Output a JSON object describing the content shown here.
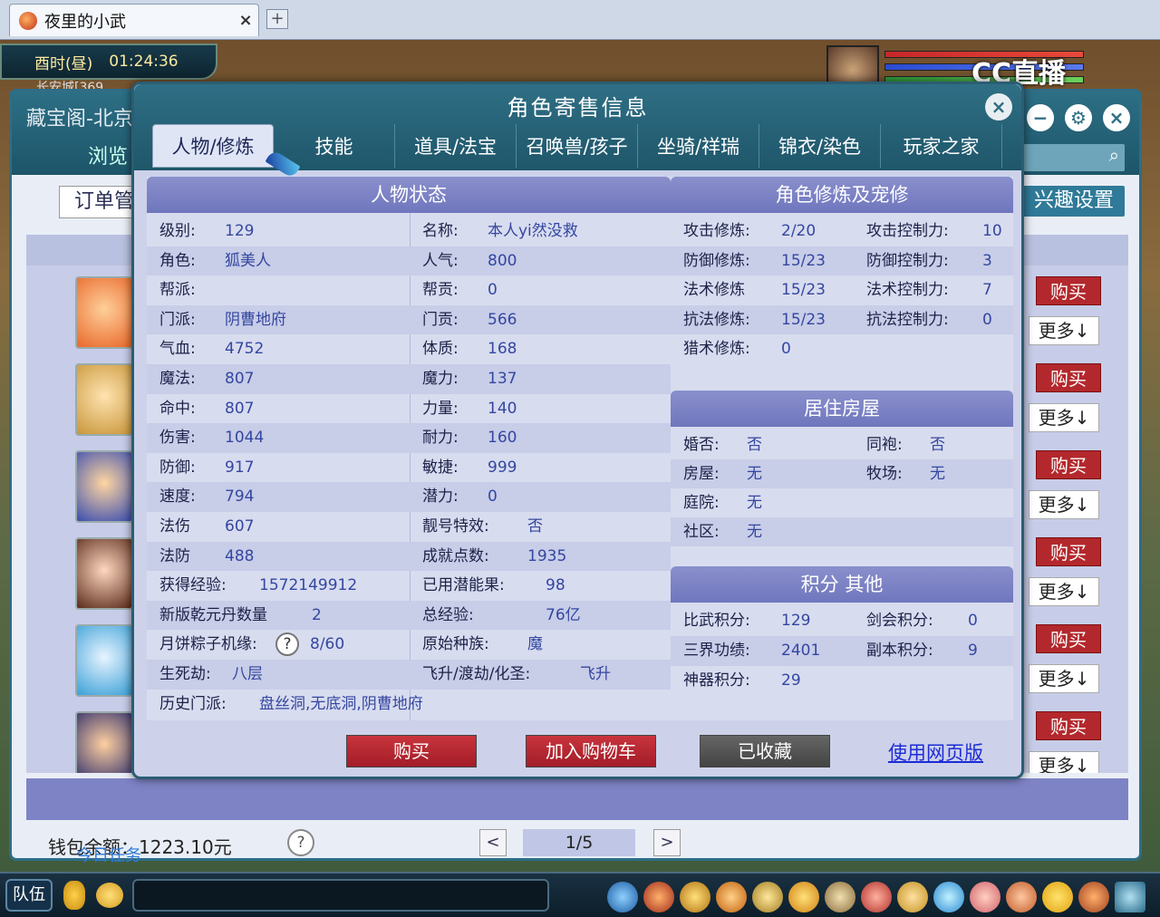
{
  "browser": {
    "tab_title": "夜里的小武",
    "tab_close": "×",
    "new_tab": "+"
  },
  "hud": {
    "time_period": "酉时(昼)",
    "clock": "01:24:36",
    "location": "长安城[369",
    "stream_logo": "CC直播",
    "team_button": "队伍",
    "daily_task": "今日任务"
  },
  "cbg": {
    "title": "藏宝阁-北京",
    "browse_label": "浏览",
    "order_button": "订单管",
    "interest_button": "兴趣设置",
    "side_buy_label": "购买",
    "side_more_label": "更多↓",
    "wallet": "钱包余额：1223.10元",
    "help": "?",
    "pager_prev": "<",
    "pager_next": ">",
    "pager": "1/5"
  },
  "modal": {
    "title": "角色寄售信息",
    "close": "×",
    "tabs": [
      "人物/修炼",
      "技能",
      "道具/法宝",
      "召唤兽/孩子",
      "坐骑/祥瑞",
      "锦衣/染色",
      "玩家之家"
    ],
    "active_tab": 0,
    "status": {
      "heading": "人物状态",
      "rows": [
        {
          "l1": "级别:",
          "v1": "129",
          "l2": "名称:",
          "v2": "本人yi然没救"
        },
        {
          "l1": "角色:",
          "v1": "狐美人",
          "l2": "人气:",
          "v2": "800"
        },
        {
          "l1": "帮派:",
          "v1": "",
          "l2": "帮贡:",
          "v2": "0"
        },
        {
          "l1": "门派:",
          "v1": "阴曹地府",
          "l2": "门贡:",
          "v2": "566"
        },
        {
          "l1": "气血:",
          "v1": "4752",
          "l2": "体质:",
          "v2": "168"
        },
        {
          "l1": "魔法:",
          "v1": "807",
          "l2": "魔力:",
          "v2": "137"
        },
        {
          "l1": "命中:",
          "v1": "807",
          "l2": "力量:",
          "v2": "140"
        },
        {
          "l1": "伤害:",
          "v1": "1044",
          "l2": "耐力:",
          "v2": "160"
        },
        {
          "l1": "防御:",
          "v1": "917",
          "l2": "敏捷:",
          "v2": "999"
        },
        {
          "l1": "速度:",
          "v1": "794",
          "l2": "潜力:",
          "v2": "0"
        },
        {
          "l1": "法伤",
          "v1": "607",
          "l2": "靓号特效:",
          "v2": "否"
        },
        {
          "l1": "法防",
          "v1": "488",
          "l2": "成就点数:",
          "v2": "1935"
        },
        {
          "l1": "获得经验:",
          "v1": "1572149912",
          "l2": "已用潜能果:",
          "v2": "98"
        },
        {
          "l1": "新版乾元丹数量",
          "v1": "2",
          "l2": "总经验:",
          "v2": "76亿"
        },
        {
          "l1": "月饼粽子机缘:",
          "v1": "8/60",
          "l2": "原始种族:",
          "v2": "魔"
        },
        {
          "l1": "生死劫:",
          "v1": "八层",
          "l2": "飞升/渡劫/化圣:",
          "v2": "飞升"
        },
        {
          "l1": "历史门派:",
          "v1": "盘丝洞,无底洞,阴曹地府",
          "l2": "",
          "v2": ""
        }
      ]
    },
    "cultivation": {
      "heading": "角色修炼及宠修",
      "rows": [
        {
          "l1": "攻击修炼:",
          "v1": "2/20",
          "l2": "攻击控制力:",
          "v2": "10"
        },
        {
          "l1": "防御修炼:",
          "v1": "15/23",
          "l2": "防御控制力:",
          "v2": "3"
        },
        {
          "l1": "法术修炼",
          "v1": "15/23",
          "l2": "法术控制力:",
          "v2": "7"
        },
        {
          "l1": "抗法修炼:",
          "v1": "15/23",
          "l2": "抗法控制力:",
          "v2": "0"
        },
        {
          "l1": "猎术修炼:",
          "v1": "0",
          "l2": "",
          "v2": ""
        }
      ]
    },
    "housing": {
      "heading": "居住房屋",
      "rows": [
        {
          "l1": "婚否:",
          "v1": "否",
          "l2": "同袍:",
          "v2": "否"
        },
        {
          "l1": "房屋:",
          "v1": "无",
          "l2": "牧场:",
          "v2": "无"
        },
        {
          "l1": "庭院:",
          "v1": "无",
          "l2": "",
          "v2": ""
        },
        {
          "l1": "社区:",
          "v1": "无",
          "l2": "",
          "v2": ""
        }
      ]
    },
    "points": {
      "heading": "积分 其他",
      "rows": [
        {
          "l1": "比武积分:",
          "v1": "129",
          "l2": "剑会积分:",
          "v2": "0"
        },
        {
          "l1": "三界功绩:",
          "v1": "2401",
          "l2": "副本积分:",
          "v2": "9"
        },
        {
          "l1": "神器积分:",
          "v1": "29",
          "l2": "",
          "v2": ""
        }
      ]
    },
    "help": "?",
    "buttons": {
      "buy": "购买",
      "cart": "加入购物车",
      "favorited": "已收藏",
      "web": "使用网页版"
    }
  },
  "colors": {
    "header_teal": "#2f6f85",
    "panel_head": "#7a80c4",
    "buy_red": "#b3282c",
    "value_blue": "#3447a0"
  }
}
